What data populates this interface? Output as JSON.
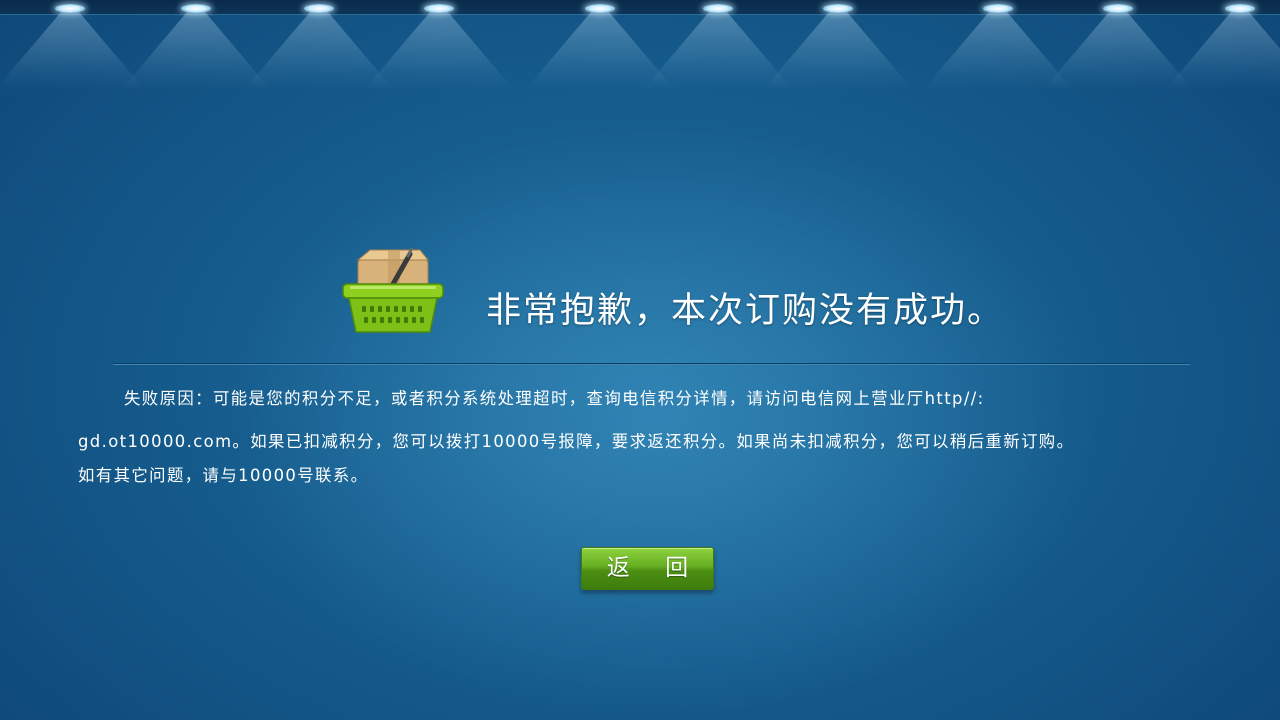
{
  "error": {
    "title": "非常抱歉，本次订购没有成功。",
    "message_lines": [
      "失败原因：可能是您的积分不足，或者积分系统处理超时，查询电信积分详情，请访问电信网上营业厅http//:",
      "gd.ot10000.com。如果已扣减积分，您可以拨打10000号报障，要求返还积分。如果尚未扣减积分，您可以稍后重新订购。",
      "如有其它问题，请与10000号联系。"
    ],
    "icon": "shopping-basket-icon"
  },
  "actions": {
    "back_label": "返 回"
  },
  "colors": {
    "background": "#14598a",
    "text": "#ffffff",
    "button": "#5a9f1a"
  }
}
